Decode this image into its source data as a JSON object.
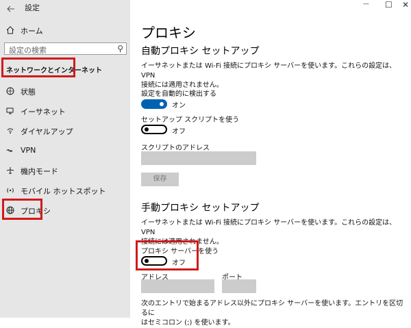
{
  "titlebar": {
    "back_icon": "back-arrow-icon",
    "title": "設定",
    "minimize": "—",
    "maximize": "☐",
    "close": "✕"
  },
  "sidebar": {
    "home": "ホーム",
    "search_placeholder": "設定の検索",
    "section_title": "ネットワークとインターネット",
    "items": [
      {
        "label": "状態",
        "icon": "globe-status-icon"
      },
      {
        "label": "イーサネット",
        "icon": "monitor-icon"
      },
      {
        "label": "ダイヤルアップ",
        "icon": "dialup-icon"
      },
      {
        "label": "VPN",
        "icon": "vpn-icon"
      },
      {
        "label": "機内モード",
        "icon": "airplane-icon"
      },
      {
        "label": "モバイル ホットスポット",
        "icon": "hotspot-icon"
      },
      {
        "label": "プロキシ",
        "icon": "globe-icon"
      }
    ]
  },
  "main": {
    "title": "プロキシ",
    "auto": {
      "heading": "自動プロキシ セットアップ",
      "desc_line1": "イーサネットまたは Wi-Fi 接続にプロキシ サーバーを使います。これらの設定は、VPN",
      "desc_line2": "接続には適用されません。",
      "detect_label": "設定を自動的に検出する",
      "detect_state": "オン",
      "script_label": "セットアップ スクリプトを使う",
      "script_state": "オフ",
      "address_label": "スクリプトのアドレス",
      "address_value": "",
      "save_button": "保存"
    },
    "manual": {
      "heading": "手動プロキシ セットアップ",
      "desc_line1": "イーサネットまたは Wi-Fi 接続にプロキシ サーバーを使います。これらの設定は、VPN",
      "desc_line2": "接続には適用されません。",
      "use_label": "プロキシ サーバーを使う",
      "use_state": "オフ",
      "address_label": "アドレス",
      "port_label": "ポート",
      "bottom_line1": "次のエントリで始まるアドレス以外にプロキシ サーバーを使います。エントリを区切るに",
      "bottom_line2": "はセミコロン (;) を使います。"
    }
  },
  "colors": {
    "accent": "#0063b1",
    "highlight": "#d2191a",
    "sidebar_bg": "#e6e6e6",
    "disabled_field": "#cccccc"
  }
}
